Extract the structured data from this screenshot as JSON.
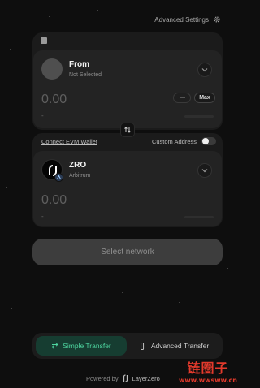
{
  "header": {
    "advanced_settings_label": "Advanced Settings",
    "settings_icon": "gear-icon"
  },
  "from": {
    "title": "From",
    "subtitle": "Not Selected",
    "amount_placeholder": "0.00",
    "usd_value": "-",
    "max_label": "Max"
  },
  "swap_icon": "swap-vertical-icon",
  "destination": {
    "connect_wallet_label": "Connect EVM Wallet",
    "custom_address_label": "Custom Address",
    "custom_address_enabled": false
  },
  "to": {
    "token_symbol": "ZRO",
    "network": "Arbitrum",
    "amount_placeholder": "0.00",
    "usd_value": "-"
  },
  "action": {
    "select_network_label": "Select network"
  },
  "modes": {
    "simple_label": "Simple Transfer",
    "advanced_label": "Advanced Transfer",
    "active": "simple"
  },
  "footer": {
    "powered_by": "Powered by",
    "brand": "LayerZero"
  },
  "watermark": {
    "line1": "链圈子",
    "line2": "www.wwsww.cn"
  },
  "colors": {
    "background": "#0e0e0e",
    "card": "#1b1b1b",
    "accent_green": "#4ed6a0",
    "watermark_red": "#e23a2c"
  }
}
